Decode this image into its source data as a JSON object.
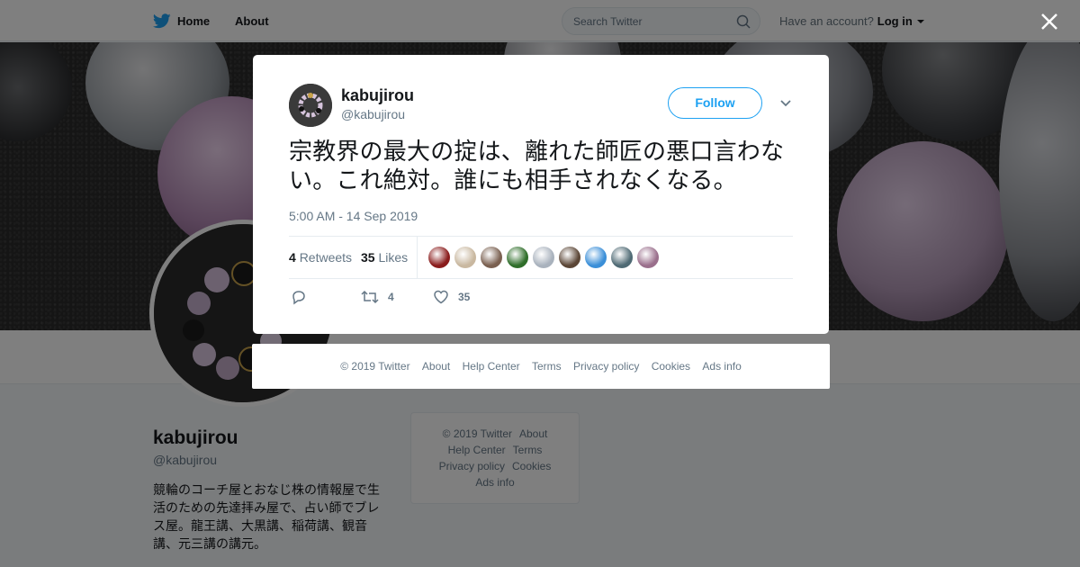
{
  "topbar": {
    "home_label": "Home",
    "about_label": "About",
    "search_placeholder": "Search Twitter",
    "have_account": "Have an account?",
    "login_label": "Log in"
  },
  "profile": {
    "name": "kabujirou",
    "handle": "@kabujirou",
    "bio": "競輪のコーチ屋とおなじ株の情報屋で生活のための先達拝み屋で、占い師でブレス屋。龍王講、大黒講、稲荷講、観音講、元三講の講元。"
  },
  "side_footer": {
    "copyright": "© 2019 Twitter",
    "about": "About",
    "help": "Help Center",
    "terms": "Terms",
    "privacy": "Privacy policy",
    "cookies": "Cookies",
    "ads": "Ads info"
  },
  "tweet": {
    "author_name": "kabujirou",
    "author_handle": "@kabujirou",
    "follow_label": "Follow",
    "text": "宗教界の最大の掟は、離れた師匠の悪口言わない。これ絶対。誰にも相手されなくなる。",
    "timestamp": "5:00 AM - 14 Sep 2019",
    "retweets_count": "4",
    "retweets_label": "Retweets",
    "likes_count": "35",
    "likes_label": "Likes",
    "action_retweets": "4",
    "action_likes": "35",
    "liker_colors": [
      "#8a1c1c",
      "#c9b8a0",
      "#7a6050",
      "#2f6e2a",
      "#a9b2bd",
      "#5b4636",
      "#3b8fd8",
      "#4f6a74",
      "#9a6f8c"
    ]
  },
  "modal_footer": {
    "copyright": "© 2019 Twitter",
    "about": "About",
    "help": "Help Center",
    "terms": "Terms",
    "privacy": "Privacy policy",
    "cookies": "Cookies",
    "ads": "Ads info"
  },
  "colors": {
    "twitter_blue": "#1da1f2",
    "text_dark": "#14171a",
    "text_muted": "#657786"
  }
}
